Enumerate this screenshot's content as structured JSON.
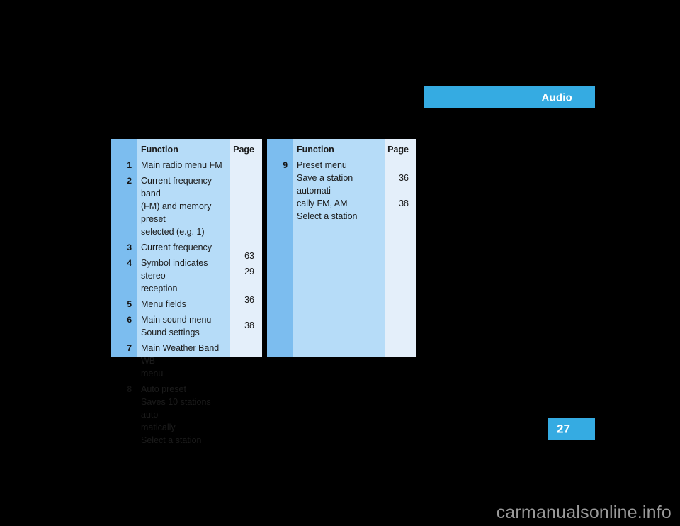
{
  "section_header": {
    "label": "Audio",
    "bar_color": "#35ABE2",
    "text_color": "#ffffff"
  },
  "page_footer": {
    "page_number": "27",
    "box_color": "#35ABE2"
  },
  "watermark": {
    "text": "carmanualsonline.info"
  },
  "colors": {
    "edge_stripe": "#7CBDEF",
    "function_column": "#B6DCF8",
    "page_column": "#E4EFFA",
    "accent": "#35ABE2",
    "background": "#000000"
  },
  "tables": [
    {
      "id": "left",
      "headers": {
        "function": "Function",
        "page": "Page"
      },
      "rows": [
        {
          "num": "1",
          "function": "Main radio menu FM",
          "page": ""
        },
        {
          "num": "2",
          "function": "Current frequency band\n(FM) and memory preset\nselected (e.g. 1)",
          "page": ""
        },
        {
          "num": "3",
          "function": "Current frequency",
          "page": ""
        },
        {
          "num": "4",
          "function": "Symbol indicates stereo\nreception",
          "page": ""
        },
        {
          "num": "5",
          "function": "Menu fields",
          "page": ""
        },
        {
          "num": "6",
          "function": "Main sound menu\nSound settings",
          "page": "\n63"
        },
        {
          "num": "7",
          "function": "Main Weather Band WB\nmenu",
          "page": "29"
        },
        {
          "num": "8",
          "function": "Auto preset\nSaves 10 stations auto-\nmatically\nSelect a station",
          "page": "\n36\n\n38"
        }
      ]
    },
    {
      "id": "right",
      "headers": {
        "function": "Function",
        "page": "Page"
      },
      "rows": [
        {
          "num": "9",
          "function": "Preset menu\nSave a station automati-\ncally FM, AM\nSelect a station",
          "page": "\n36\n\n38"
        }
      ]
    }
  ]
}
